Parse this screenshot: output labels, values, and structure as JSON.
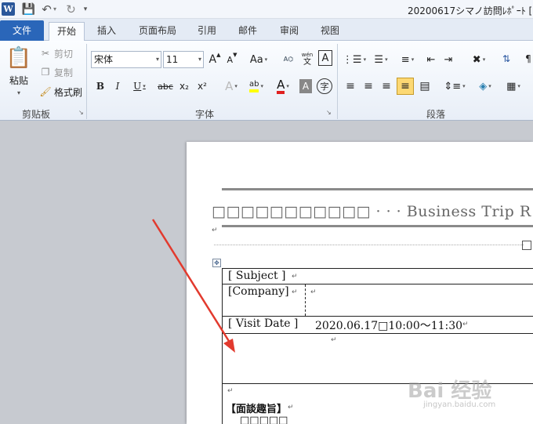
{
  "window": {
    "title": "20200617シマノ訪問ﾚﾎﾟｰﾄ [",
    "app_icon": "W"
  },
  "tabs": [
    {
      "label": "文件"
    },
    {
      "label": "开始"
    },
    {
      "label": "插入"
    },
    {
      "label": "页面布局"
    },
    {
      "label": "引用"
    },
    {
      "label": "邮件"
    },
    {
      "label": "审阅"
    },
    {
      "label": "视图"
    }
  ],
  "clipboard": {
    "paste": "粘贴",
    "cut": "剪切",
    "copy": "复制",
    "format_painter": "格式刷",
    "group_label": "剪贴板"
  },
  "font": {
    "name": "宋体",
    "size": "11",
    "grow": "A",
    "shrink": "A",
    "change_case": "Aa",
    "bold": "B",
    "italic": "I",
    "underline": "U",
    "strike": "abc",
    "subscript": "x₂",
    "superscript": "x²",
    "text_effect": "A",
    "highlight": "ab",
    "font_color": "A",
    "char_shading": "A",
    "enclose": "字",
    "phonetic": "wén",
    "char_border": "A",
    "group_label": "字体"
  },
  "paragraph": {
    "group_label": "段落"
  },
  "colors": {
    "accent_blue": "#2a66b9",
    "highlight_yellow": "#ffff00",
    "font_red": "#e02020",
    "arrow_red": "#e23a2e"
  },
  "document": {
    "heading": "□□□□□□□□□□□ · · · Business Trip R",
    "rows": {
      "subject": "[ Subject ]",
      "company": "[Company]",
      "visit_label": "[ Visit Date ]",
      "visit_value": "2020.06.17□10:00～11:30"
    },
    "section_title": "【面談趣旨】",
    "section_body": "□□□□□",
    "para_mark": "↵"
  },
  "watermark": {
    "main": "Bai 经验",
    "sub": "jingyan.baidu.com"
  }
}
